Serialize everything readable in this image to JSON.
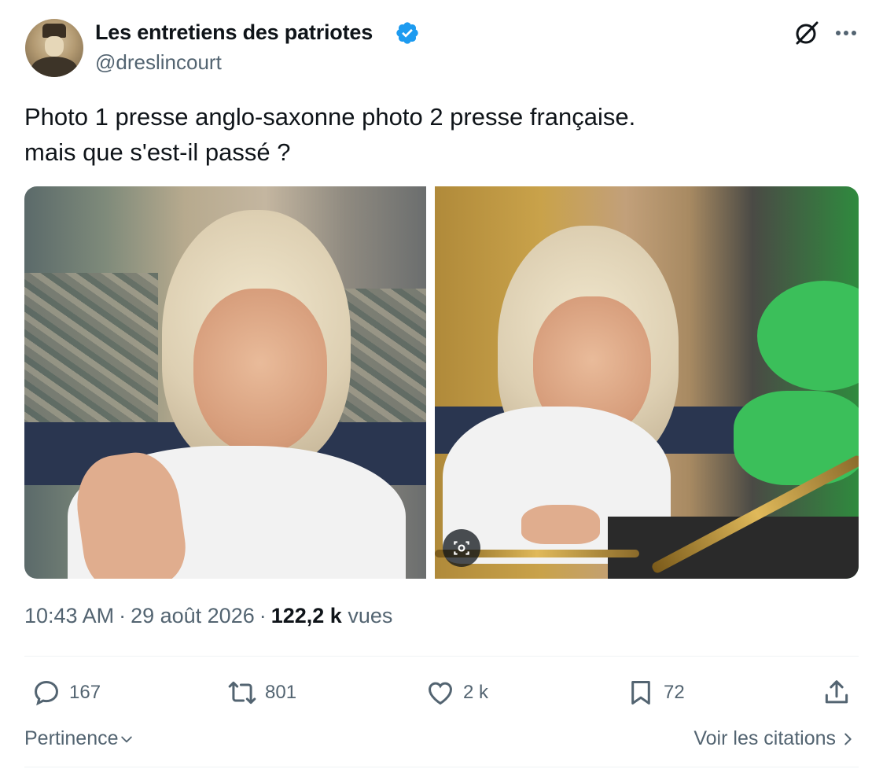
{
  "author": {
    "name": "Les entretiens des patriotes",
    "handle": "@dreslincourt",
    "verified_color": "#1d9bf0",
    "avatar_icon": "avatar-portrait"
  },
  "header_actions": {
    "grok_icon": "grok-icon",
    "more_icon": "more-icon"
  },
  "tweet": {
    "line1": "Photo 1 presse anglo-saxonne photo 2 presse française.",
    "line2": "mais que s'est-il passé ?"
  },
  "meta": {
    "time": "10:43 AM",
    "separator": "·",
    "date": "29 août 2026",
    "views_count": "122,2 k",
    "views_label": "vues"
  },
  "actions": {
    "replies": "167",
    "retweets": "801",
    "likes": "2 k",
    "bookmarks": "72"
  },
  "footer": {
    "sort_label": "Pertinence",
    "quotes_label": "Voir les citations"
  },
  "colors": {
    "text": "#0f1419",
    "secondary": "#536471",
    "divider": "#eff3f4",
    "accent": "#1d9bf0"
  }
}
